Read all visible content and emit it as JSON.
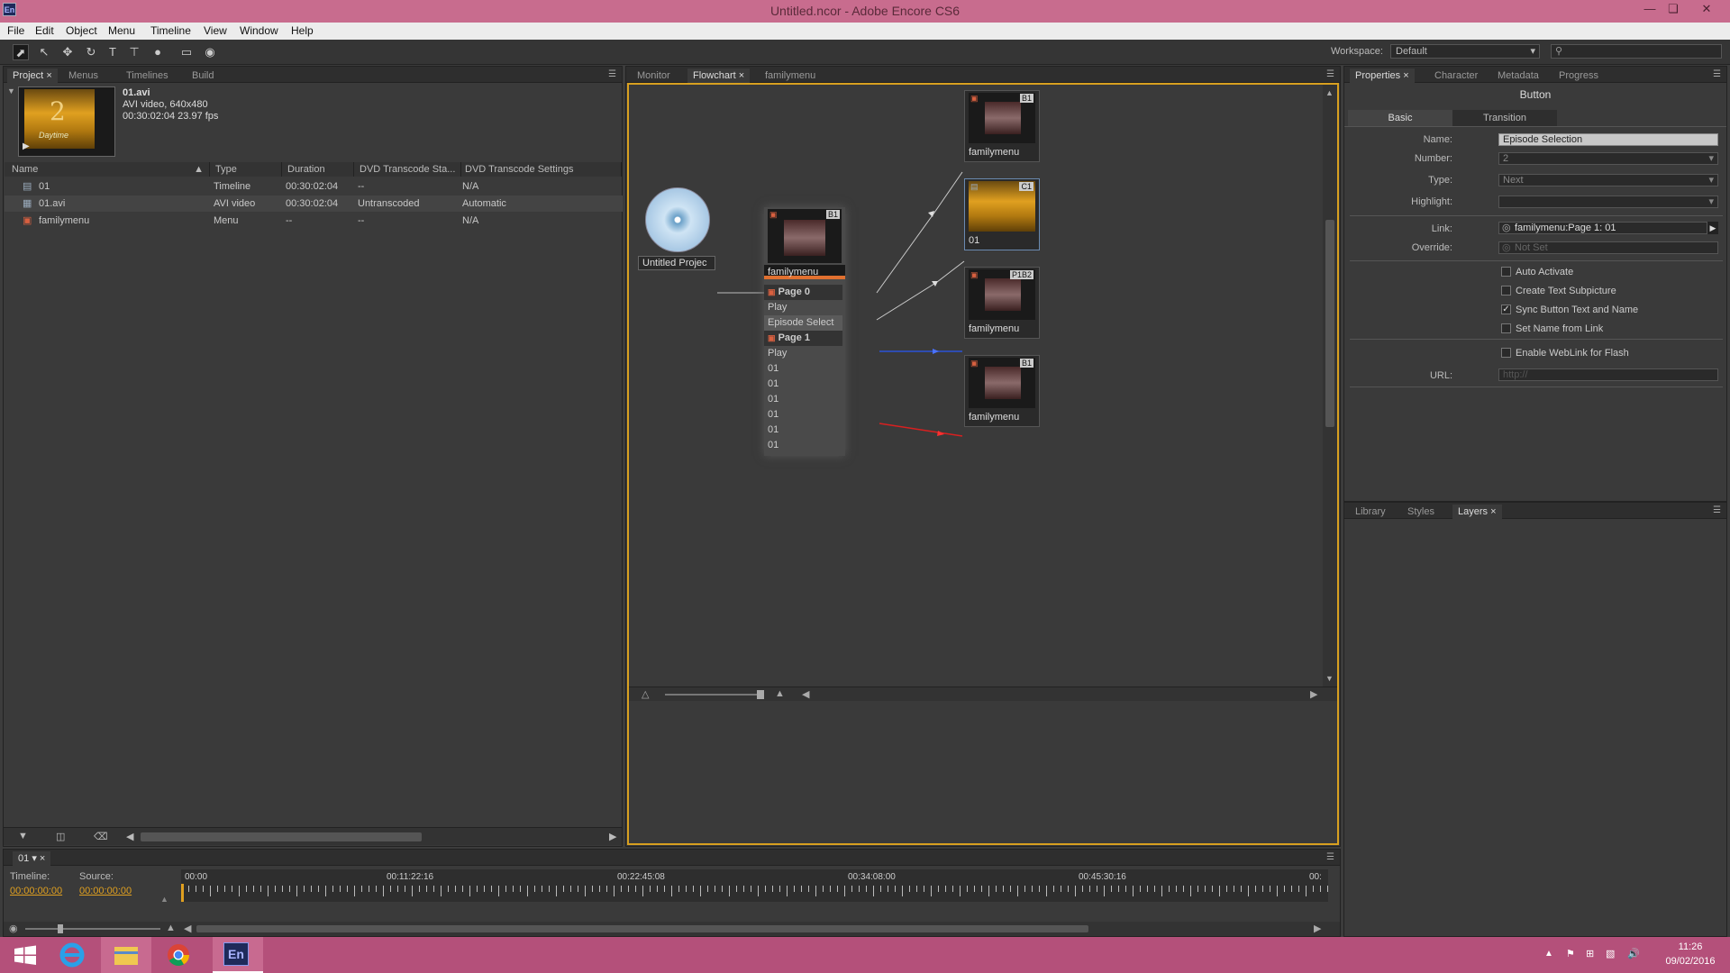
{
  "window": {
    "title": "Untitled.ncor - Adobe Encore CS6",
    "app_icon": "En"
  },
  "menubar": [
    "File",
    "Edit",
    "Object",
    "Menu",
    "Timeline",
    "View",
    "Window",
    "Help"
  ],
  "workspace": {
    "label": "Workspace:",
    "value": "Default"
  },
  "project_panel": {
    "tabs": [
      "Project",
      "Menus",
      "Timelines",
      "Build"
    ],
    "preview": {
      "filename": "01.avi",
      "line1": "AVI video, 640x480",
      "line2": "00:30:02:04 23.97 fps",
      "thumb_text": "Daytime"
    },
    "columns": [
      "Name",
      "Type",
      "Duration",
      "DVD Transcode Sta...",
      "DVD Transcode Settings"
    ],
    "rows": [
      {
        "name": "01",
        "type": "Timeline",
        "duration": "00:30:02:04",
        "status": "--",
        "settings": "N/A"
      },
      {
        "name": "01.avi",
        "type": "AVI video",
        "duration": "00:30:02:04",
        "status": "Untranscoded",
        "settings": "Automatic"
      },
      {
        "name": "familymenu",
        "type": "Menu",
        "duration": "--",
        "status": "--",
        "settings": "N/A"
      }
    ]
  },
  "center_panel": {
    "tabs": [
      "Monitor",
      "Flowchart",
      "familymenu"
    ],
    "flowchart": {
      "disc_label": "Untitled Projec",
      "menu_node": {
        "title": "familymenu",
        "badge": "B1"
      },
      "list": [
        "Page 0",
        "Play",
        "Episode Select",
        "Page 1",
        "Play",
        "01",
        "01",
        "01",
        "01",
        "01",
        "01"
      ],
      "targets": [
        {
          "label": "familymenu",
          "badge": "B1"
        },
        {
          "label": "01",
          "badge": "C1"
        },
        {
          "label": "familymenu",
          "badge": "P1B2"
        },
        {
          "label": "familymenu",
          "badge": "B1"
        }
      ]
    }
  },
  "properties_panel": {
    "tabs": [
      "Properties",
      "Character",
      "Metadata",
      "Progress"
    ],
    "heading": "Button",
    "subtabs": [
      "Basic",
      "Transition"
    ],
    "fields": {
      "name_label": "Name:",
      "name_value": "Episode Selection",
      "number_label": "Number:",
      "number_value": "2",
      "type_label": "Type:",
      "type_value": "Next",
      "highlight_label": "Highlight:",
      "highlight_value": "",
      "link_label": "Link:",
      "link_value": "familymenu:Page 1: 01",
      "override_label": "Override:",
      "override_value": "Not Set",
      "url_label": "URL:",
      "url_value": "http://"
    },
    "checkboxes": [
      {
        "label": "Auto Activate",
        "checked": false
      },
      {
        "label": "Create Text Subpicture",
        "checked": false
      },
      {
        "label": "Sync Button Text and Name",
        "checked": true
      },
      {
        "label": "Set Name from Link",
        "checked": false
      },
      {
        "label": "Enable WebLink for Flash",
        "checked": false
      }
    ]
  },
  "library_panel": {
    "tabs": [
      "Library",
      "Styles",
      "Layers"
    ]
  },
  "timeline_panel": {
    "tab": "01",
    "timeline_label": "Timeline:",
    "timeline_time": "00:00:00:00",
    "source_label": "Source:",
    "source_time": "00:00:00:00",
    "ruler": [
      "00:00",
      "00:11:22:16",
      "00:22:45:08",
      "00:34:08:00",
      "00:45:30:16",
      "00:"
    ]
  },
  "taskbar": {
    "time": "11:26",
    "date": "09/02/2016",
    "running_app": "En"
  },
  "colors": {
    "accent_highlight": "#d8a020",
    "link_blue": "#2a52d8",
    "link_red": "#d82020",
    "taskbar": "#b4507a",
    "titlebar": "#c86c8e"
  }
}
